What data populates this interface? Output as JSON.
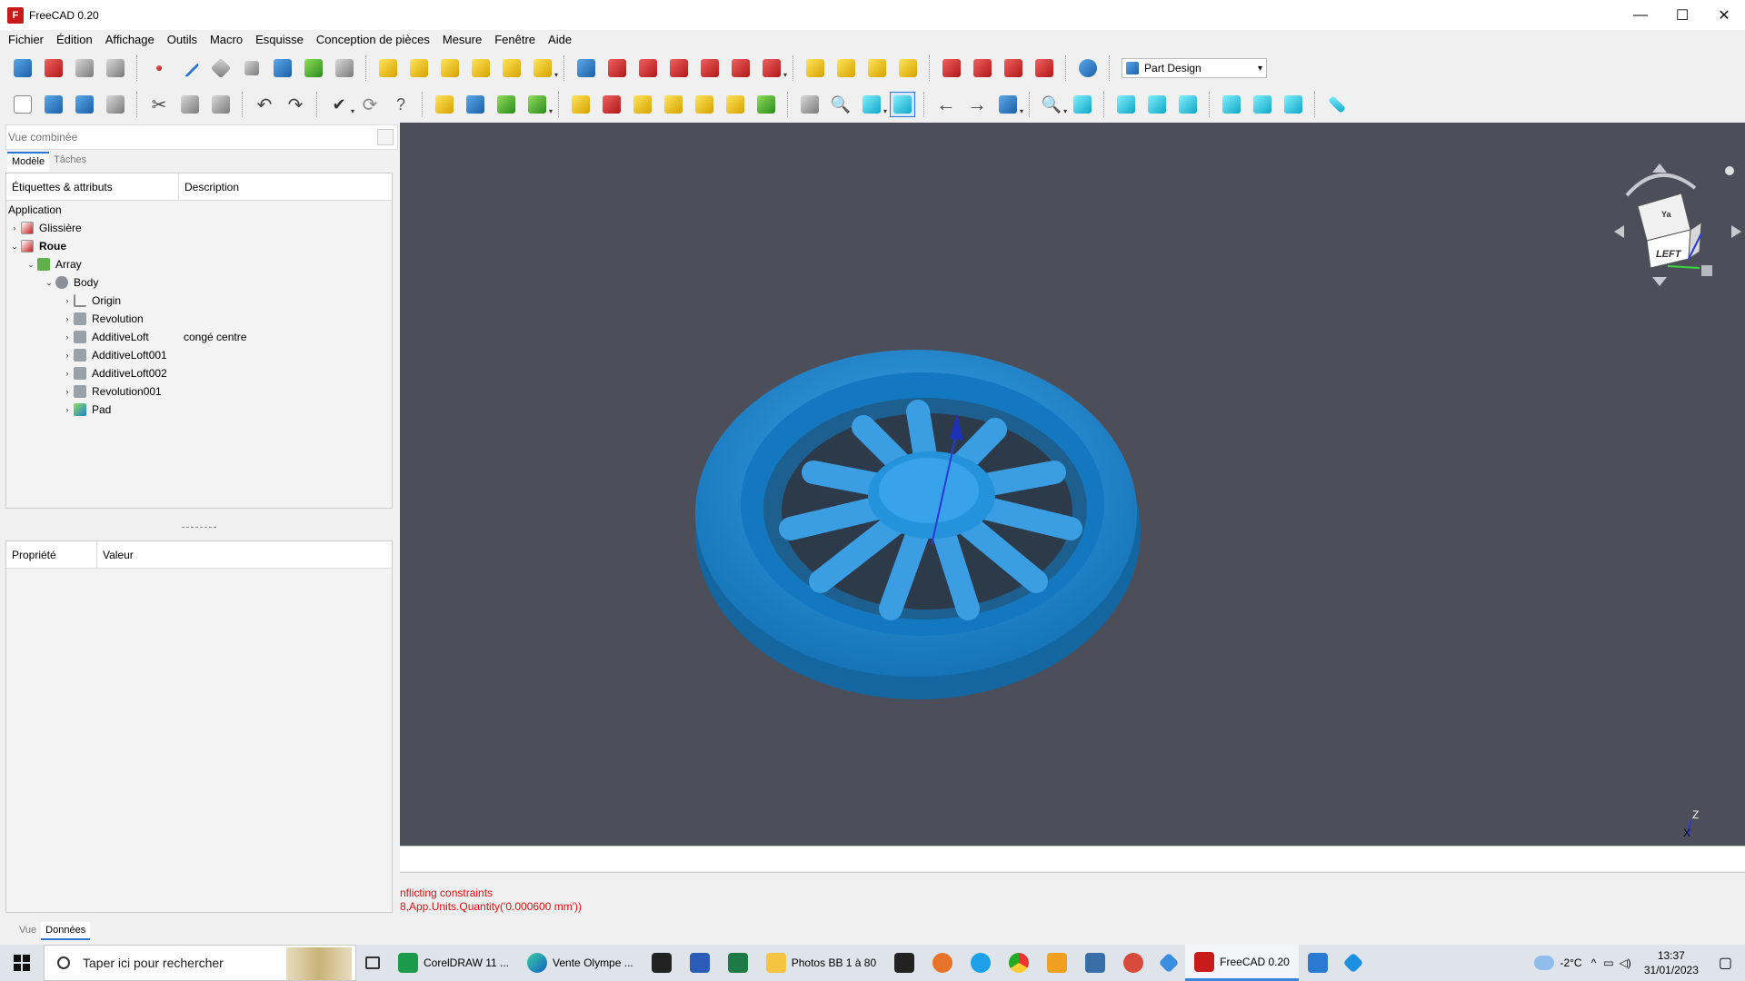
{
  "window": {
    "title": "FreeCAD 0.20",
    "minimize": "—",
    "maximize": "☐",
    "close": "✕"
  },
  "menu": [
    "Fichier",
    "Édition",
    "Affichage",
    "Outils",
    "Macro",
    "Esquisse",
    "Conception de pièces",
    "Mesure",
    "Fenêtre",
    "Aide"
  ],
  "workbench": {
    "selected": "Part Design"
  },
  "combo": {
    "header": "Vue combinée",
    "tabs": [
      "Modèle",
      "Tâches"
    ],
    "tree_columns": [
      "Étiquettes & attributs",
      "Description"
    ],
    "tree": [
      {
        "label": "Application",
        "desc": "",
        "icon": "none",
        "arrow": ""
      },
      {
        "label": "Glissière",
        "desc": "",
        "icon": "document-icon",
        "arrow": "›"
      },
      {
        "label": "Roue",
        "desc": "",
        "icon": "document-icon",
        "arrow": "⌄"
      },
      {
        "label": "Array",
        "desc": "",
        "icon": "array-icon",
        "arrow": "⌄"
      },
      {
        "label": "Body",
        "desc": "",
        "icon": "body-icon",
        "arrow": "⌄"
      },
      {
        "label": "Origin",
        "desc": "",
        "icon": "origin-icon",
        "arrow": "›"
      },
      {
        "label": "Revolution",
        "desc": "",
        "icon": "revolution-icon",
        "arrow": "›"
      },
      {
        "label": "AdditiveLoft",
        "desc": "congé centre",
        "icon": "loft-icon",
        "arrow": "›"
      },
      {
        "label": "AdditiveLoft001",
        "desc": "",
        "icon": "loft-icon",
        "arrow": "›"
      },
      {
        "label": "AdditiveLoft002",
        "desc": "",
        "icon": "loft-icon",
        "arrow": "›"
      },
      {
        "label": "Revolution001",
        "desc": "",
        "icon": "revolution-icon",
        "arrow": "›"
      },
      {
        "label": "Pad",
        "desc": "",
        "icon": "pad-icon",
        "arrow": "›"
      }
    ],
    "prop_columns": [
      "Propriété",
      "Valeur"
    ],
    "bottom_tabs": [
      "Vue",
      "Données"
    ]
  },
  "navcube": {
    "face_front": "LEFT",
    "face_top": "Ya"
  },
  "axis": {
    "z": "Z",
    "x": "X"
  },
  "report": {
    "lines": [
      "nflicting constraints",
      "8,App.Units.Quantity('0.000600 mm'))"
    ]
  },
  "taskbar": {
    "search_placeholder": "Taper ici pour rechercher",
    "items": [
      "CorelDRAW 11 ...",
      "Vente Olympe ...",
      "Photos BB 1 à 80",
      "FreeCAD 0.20"
    ],
    "temperature": "-2°C",
    "time": "13:37",
    "date": "31/01/2023"
  },
  "colors": {
    "viewport_bg": "#4c4f5a",
    "model": "#1f8fd8",
    "error_text": "#e01010",
    "accent": "#2b78d4"
  }
}
